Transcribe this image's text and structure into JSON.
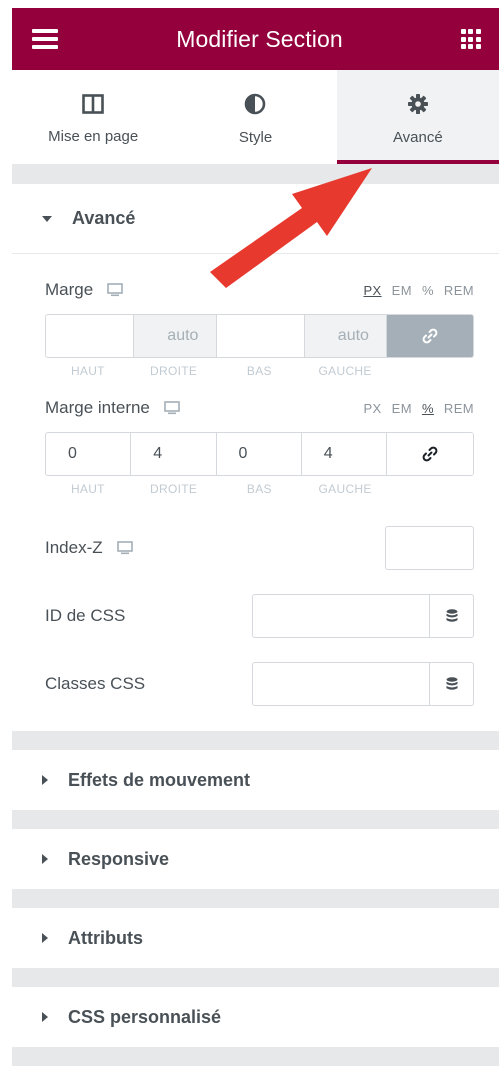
{
  "header": {
    "title": "Modifier Section"
  },
  "tabs": [
    {
      "label": "Mise en page",
      "icon": "columns-icon"
    },
    {
      "label": "Style",
      "icon": "half-circle-icon"
    },
    {
      "label": "Avancé",
      "icon": "gear-icon",
      "active": true
    }
  ],
  "section": {
    "title": "Avancé",
    "margin": {
      "label": "Marge",
      "units": [
        "PX",
        "EM",
        "%",
        "REM"
      ],
      "active_unit": "PX",
      "values": {
        "top": "",
        "right": "auto",
        "bottom": "",
        "left": "auto"
      }
    },
    "padding": {
      "label": "Marge interne",
      "units": [
        "PX",
        "EM",
        "%",
        "REM"
      ],
      "active_unit": "%",
      "values": {
        "top": "0",
        "right": "4",
        "bottom": "0",
        "left": "4"
      }
    },
    "dimension_labels": [
      "HAUT",
      "DROITE",
      "BAS",
      "GAUCHE"
    ],
    "z_index": {
      "label": "Index-Z",
      "value": ""
    },
    "css_id": {
      "label": "ID de CSS",
      "value": ""
    },
    "css_classes": {
      "label": "Classes CSS",
      "value": ""
    }
  },
  "collapsed_sections": [
    "Effets de mouvement",
    "Responsive",
    "Attributs",
    "CSS personnalisé"
  ],
  "colors": {
    "header": "#93003c",
    "arrow": "#e8392f",
    "linked_bg": "#a4afb7"
  }
}
